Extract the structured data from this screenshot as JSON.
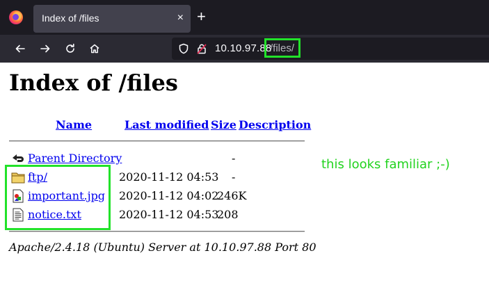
{
  "browser": {
    "tab_title": "Index of /files",
    "tab_close": "×",
    "new_tab": "+",
    "url_host": "10.10.97.88",
    "url_path": "/files/"
  },
  "page": {
    "title": "Index of /files",
    "columns": {
      "name": "Name",
      "last_modified": "Last modified",
      "size": "Size",
      "description": "Description"
    },
    "rows": [
      {
        "name": "Parent Directory",
        "date": "",
        "size": "-",
        "icon": "back-icon"
      },
      {
        "name": "ftp/",
        "date": "2020-11-12 04:53",
        "size": "-",
        "icon": "folder-icon"
      },
      {
        "name": "important.jpg",
        "date": "2020-11-12 04:02",
        "size": "246K",
        "icon": "image-icon"
      },
      {
        "name": "notice.txt",
        "date": "2020-11-12 04:53",
        "size": "208",
        "icon": "text-file-icon"
      }
    ],
    "footer": "Apache/2.4.18 (Ubuntu) Server at 10.10.97.88 Port 80"
  },
  "annotation": {
    "note": "this looks familiar ;-)",
    "highlight_color": "#22e22a"
  }
}
